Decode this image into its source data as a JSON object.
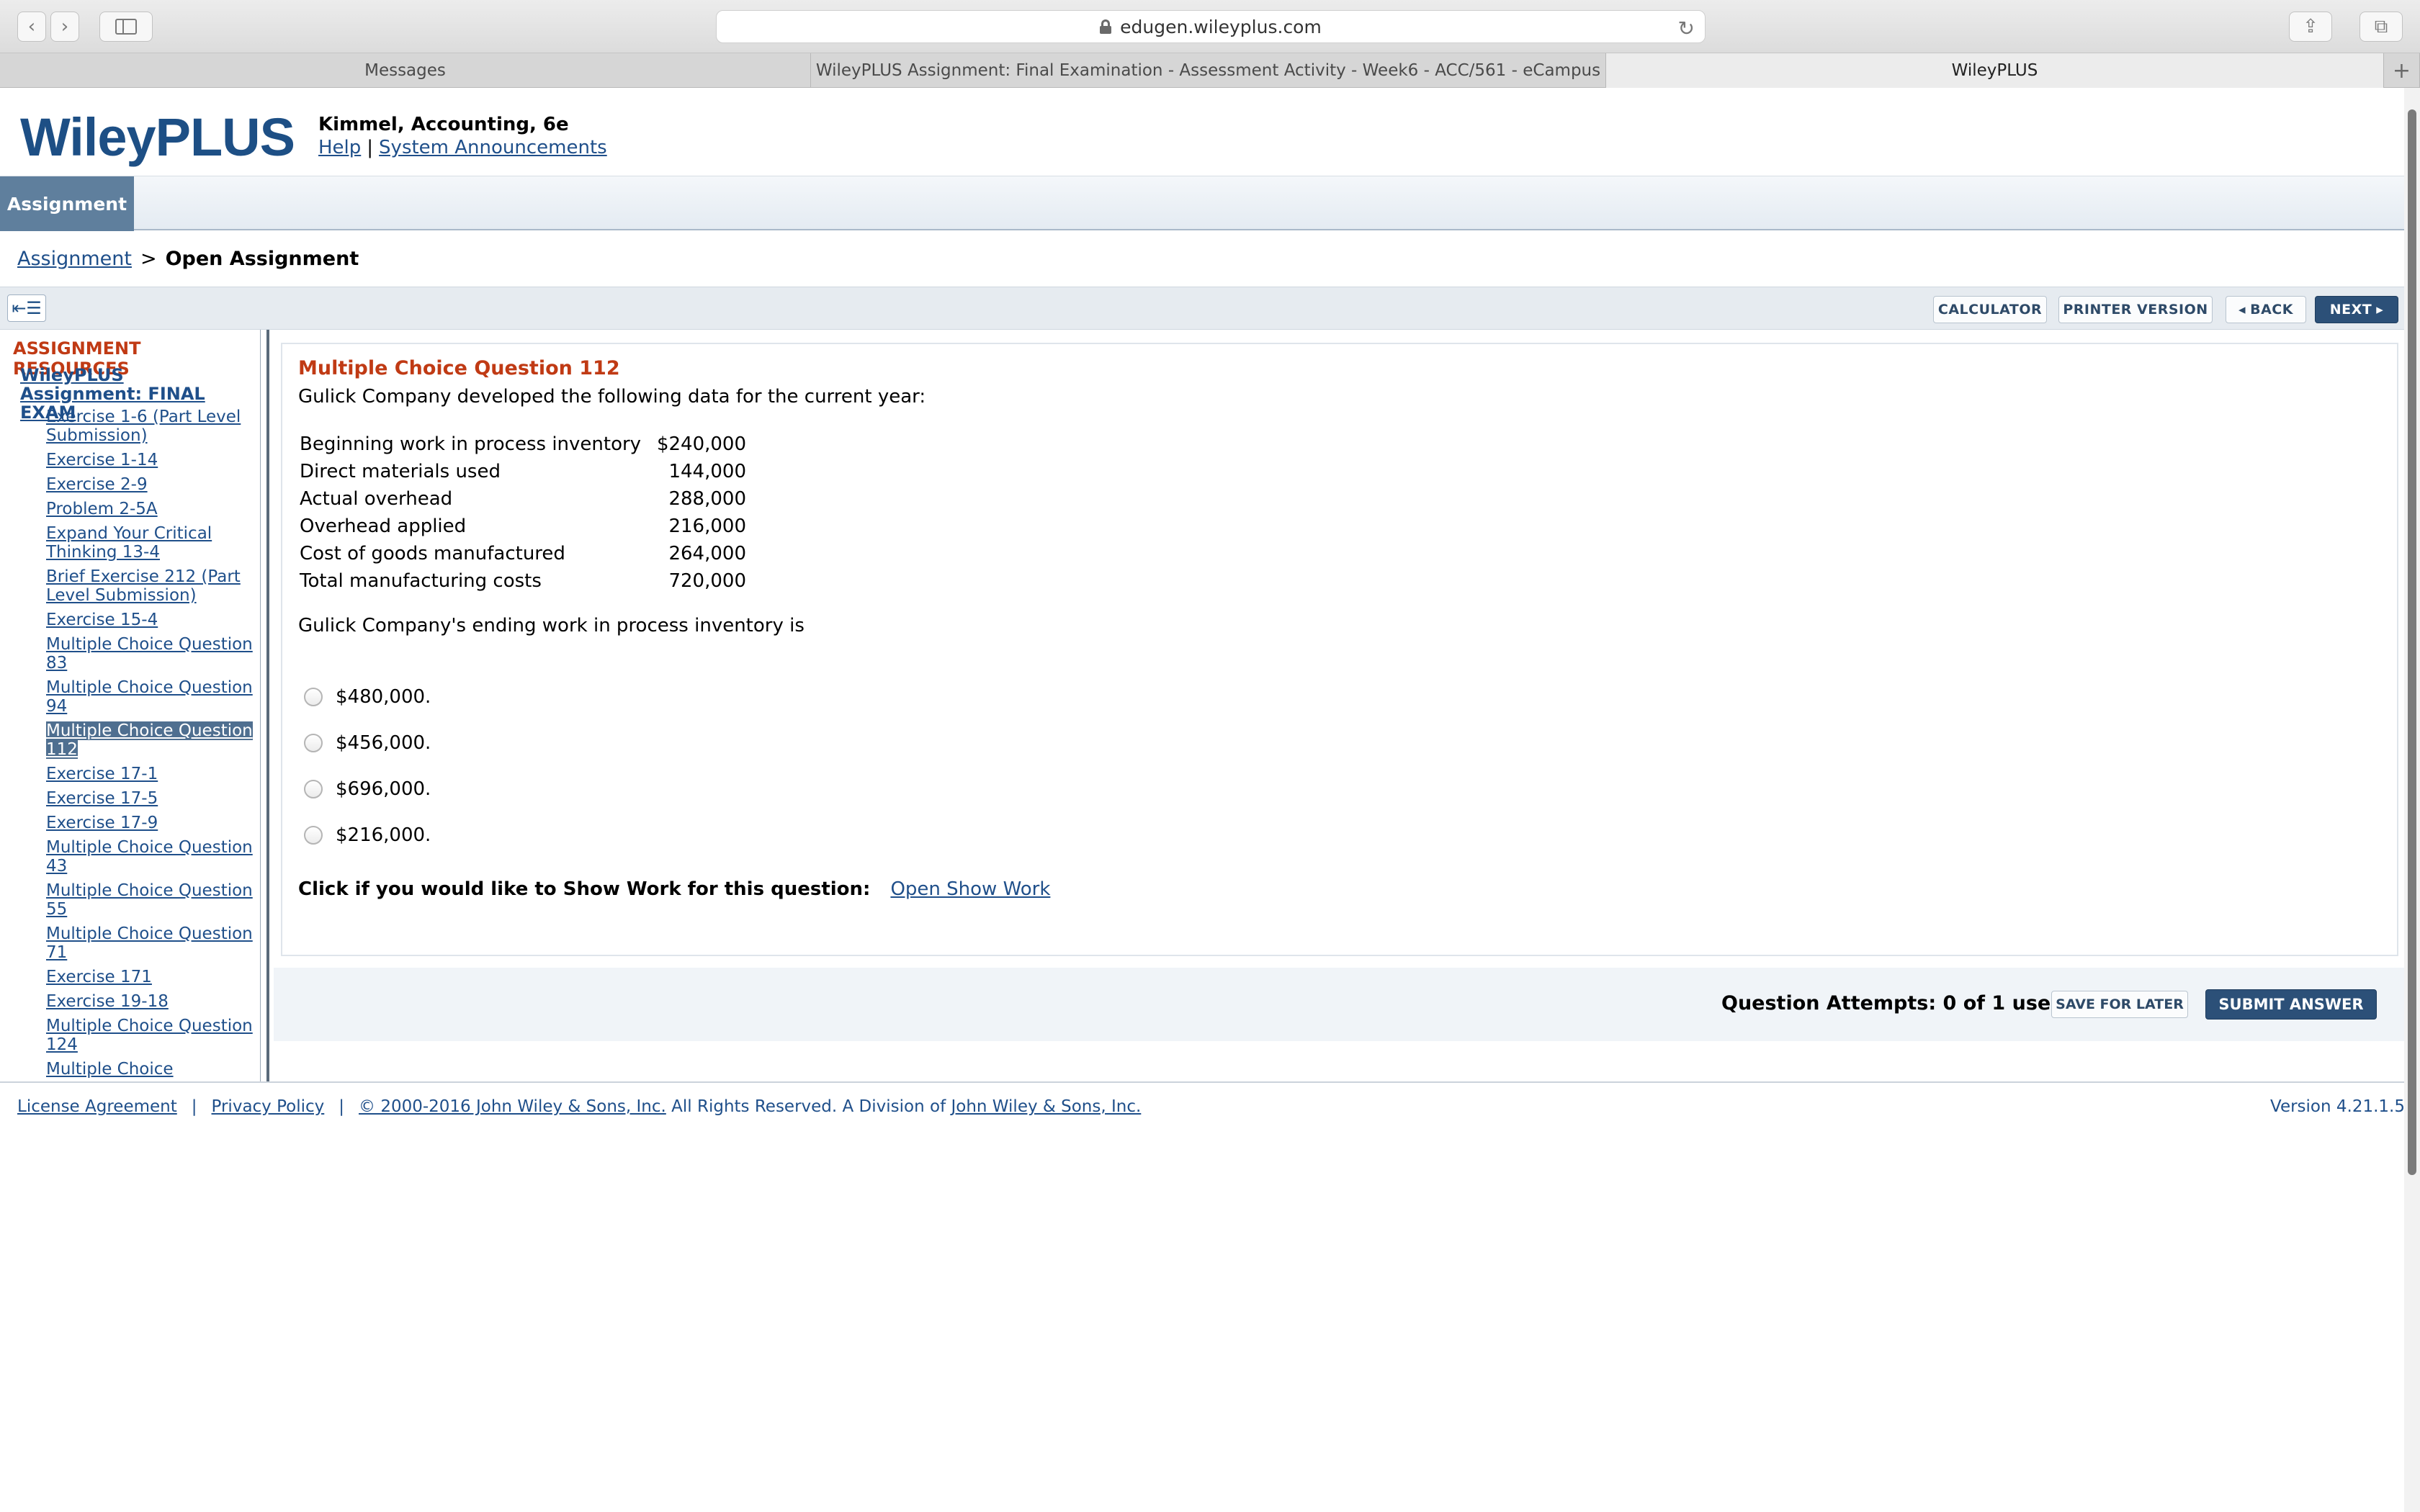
{
  "browser": {
    "url": "edugen.wileyplus.com",
    "tabs": [
      {
        "label": "Messages"
      },
      {
        "label": "WileyPLUS Assignment: Final Examination - Assessment Activity - Week6 - ACC/561 - eCampus"
      },
      {
        "label": "WileyPLUS"
      }
    ]
  },
  "header": {
    "logo": "WileyPLUS",
    "book_title": "Kimmel, Accounting, 6e",
    "help": "Help",
    "separator": "|",
    "announcements": "System Announcements"
  },
  "nav": {
    "assignment_tab": "Assignment"
  },
  "breadcrumb": {
    "parent": "Assignment",
    "separator": ">",
    "current": "Open Assignment"
  },
  "actions": {
    "calculator": "CALCULATOR",
    "printer": "PRINTER VERSION",
    "back": "BACK",
    "next": "NEXT"
  },
  "sidebar": {
    "title": "ASSIGNMENT RESOURCES",
    "assignment_link": "WileyPLUS Assignment: FINAL EXAM",
    "items": [
      {
        "label": "Exercise 1-6 (Part Level Submission)"
      },
      {
        "label": "Exercise 1-14"
      },
      {
        "label": "Exercise 2-9"
      },
      {
        "label": "Problem 2-5A"
      },
      {
        "label": "Expand Your Critical Thinking 13-4"
      },
      {
        "label": "Brief Exercise 212 (Part Level Submission)"
      },
      {
        "label": "Exercise 15-4"
      },
      {
        "label": "Multiple Choice Question 83"
      },
      {
        "label": "Multiple Choice Question 94"
      },
      {
        "label": "Multiple Choice Question 112"
      },
      {
        "label": "Exercise 17-1"
      },
      {
        "label": "Exercise 17-5"
      },
      {
        "label": "Exercise 17-9"
      },
      {
        "label": "Multiple Choice Question 43"
      },
      {
        "label": "Multiple Choice Question 55"
      },
      {
        "label": "Multiple Choice Question 71"
      },
      {
        "label": "Exercise 171"
      },
      {
        "label": "Exercise 19-18"
      },
      {
        "label": "Multiple Choice Question 124"
      },
      {
        "label": "Multiple Choice"
      }
    ]
  },
  "question": {
    "title": "Multiple Choice Question 112",
    "intro": "Gulick Company developed the following data for the current year:",
    "table": [
      {
        "label": "Beginning work in process inventory",
        "value": "$240,000"
      },
      {
        "label": "Direct materials used",
        "value": "144,000"
      },
      {
        "label": "Actual overhead",
        "value": "288,000"
      },
      {
        "label": "Overhead applied",
        "value": "216,000"
      },
      {
        "label": "Cost of goods manufactured",
        "value": "264,000"
      },
      {
        "label": "Total manufacturing costs",
        "value": "720,000"
      }
    ],
    "prompt": "Gulick Company's ending work in process inventory is",
    "choices": [
      {
        "label": "$480,000."
      },
      {
        "label": "$456,000."
      },
      {
        "label": "$696,000."
      },
      {
        "label": "$216,000."
      }
    ],
    "show_work_label": "Click if you would like to Show Work for this question:",
    "show_work_link": "Open Show Work"
  },
  "submit": {
    "attempts": "Question Attempts: 0 of 1 used",
    "save_label": "SAVE FOR LATER",
    "submit_label": "SUBMIT ANSWER"
  },
  "footer": {
    "license": "License Agreement",
    "privacy": "Privacy Policy",
    "copyright": "© 2000-2016 John Wiley & Sons, Inc.",
    "rights": " All Rights Reserved. A Division of ",
    "division": "John Wiley & Sons, Inc.",
    "pipe": "|",
    "version": "Version 4.21.1.5"
  },
  "colors": {
    "brand_blue": "#1d4f85",
    "accent_red": "#c03a14",
    "button_dark": "#2c5078",
    "selected_bg": "#4f6f90"
  }
}
